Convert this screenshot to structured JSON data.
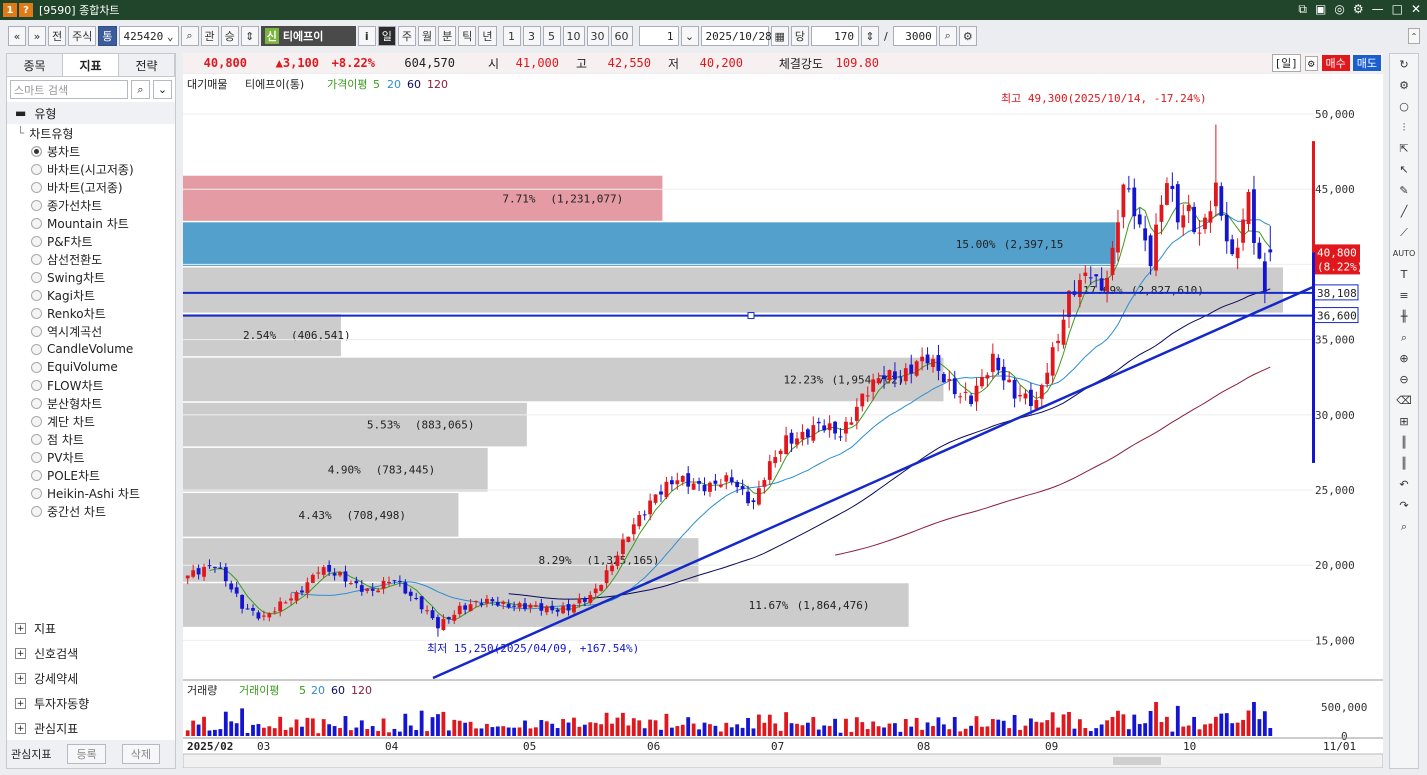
{
  "window": {
    "badge1": "1",
    "badge2": "?",
    "title": "[9590] 종합차트"
  },
  "toolbar": {
    "nav_prev": "«",
    "nav_next": "»",
    "btn_jeon": "전",
    "btn_jusik": "주식",
    "btn_tong": "통",
    "code": "425420",
    "btn_gwan": "관",
    "btn_seung": "승",
    "stock_tag": "신",
    "stock_name": "티에프이",
    "btn_info": "i",
    "periods": [
      "일",
      "주",
      "월",
      "분",
      "틱",
      "년"
    ],
    "intervals": [
      "1",
      "3",
      "5",
      "10",
      "30",
      "60"
    ],
    "unit_value": "1",
    "date": "2025/10/28",
    "btn_dang": "당",
    "count": "170",
    "slash": "/",
    "total": "3000"
  },
  "left_panel": {
    "tabs": [
      "종목",
      "지표",
      "전략"
    ],
    "active_tab": "지표",
    "search_placeholder": "스마트 검색",
    "group_title": "유형",
    "tree_root": "차트유형",
    "chart_types": [
      "봉차트",
      "바차트(시고저종)",
      "바차트(고저종)",
      "종가선차트",
      "Mountain 차트",
      "P&F차트",
      "삼선전환도",
      "Swing차트",
      "Kagi차트",
      "Renko차트",
      "역시계곡선",
      "CandleVolume",
      "EquiVolume",
      "FLOW차트",
      "분산형차트",
      "계단 차트",
      "점 차트",
      "PV차트",
      "POLE차트",
      "Heikin-Ashi 차트",
      "중간선 차트"
    ],
    "selected_chart_type": "봉차트",
    "bottom_groups": [
      "지표",
      "신호검색",
      "강세약세",
      "투자자동향",
      "관심지표"
    ],
    "fav_label": "관심지표",
    "fav_add": "등록",
    "fav_del": "삭제"
  },
  "price_bar": {
    "price": "40,800",
    "change": "▲3,100",
    "change_pct": "+8.22%",
    "volume": "604,570",
    "open_label": "시",
    "open": "41,000",
    "high_label": "고",
    "high": "42,550",
    "low_label": "저",
    "low": "40,200",
    "strength_label": "체결강도",
    "strength": "109.80",
    "period_label": "[일]",
    "buy": "매수",
    "sell": "매도"
  },
  "chart": {
    "legend": {
      "prefix": "대기매물",
      "name": "티에프이(통)",
      "ma_label": "가격이평",
      "ma_periods": [
        "5",
        "20",
        "60",
        "120"
      ]
    },
    "max_annotation": "최고 49,300(2025/10/14, -17.24%)",
    "min_annotation": "최저 15,250(2025/04/09, +167.54%)",
    "current_price_label": "40,800",
    "current_pct_label": "(8.22%)",
    "line_label_1": "38,108",
    "line_label_2": "36,600",
    "yticks": [
      "50,000",
      "45,000",
      "40,000",
      "35,000",
      "30,000",
      "25,000",
      "20,000",
      "15,000"
    ],
    "volume_legend": {
      "prefix": "거래량",
      "ma_label": "거래이평",
      "ma_periods": [
        "5",
        "20",
        "60",
        "120"
      ]
    },
    "volume_ticks": [
      "500,000",
      "0"
    ],
    "xticks": [
      "2025/02",
      "03",
      "04",
      "05",
      "06",
      "07",
      "08",
      "09",
      "10",
      "11/01"
    ],
    "colors": {
      "up": "#e0171c",
      "down": "#1515d0",
      "ma5": "#3c9a1e",
      "ma20": "#2c8fd0",
      "ma60": "#0a0a5e",
      "ma120": "#8b1e3a",
      "trend": "#1529c8"
    }
  },
  "chart_data": {
    "type": "candlestick",
    "volume_profile": [
      {
        "band": [
          42900,
          45900
        ],
        "pct": "7.71%",
        "vol": "(1,231,077)",
        "color": "#e3969f"
      },
      {
        "band": [
          39900,
          42800
        ],
        "pct": "15.00%",
        "vol": "(2,397,15",
        "color": "#4a9bc9"
      },
      {
        "band": [
          36800,
          39800
        ],
        "pct": "17.69%",
        "vol": "(2,827,610)",
        "color": "#c9c9c9"
      },
      {
        "band": [
          33900,
          36700
        ],
        "pct": "2.54%",
        "vol": "(406,541)",
        "color": "#c9c9c9"
      },
      {
        "band": [
          30900,
          33800
        ],
        "pct": "12.23%",
        "vol": "(1,954,702)",
        "color": "#c9c9c9"
      },
      {
        "band": [
          27900,
          30800
        ],
        "pct": "5.53%",
        "vol": "(883,065)",
        "color": "#c9c9c9"
      },
      {
        "band": [
          24900,
          27800
        ],
        "pct": "4.90%",
        "vol": "(783,445)",
        "color": "#c9c9c9"
      },
      {
        "band": [
          21900,
          24800
        ],
        "pct": "4.43%",
        "vol": "(708,498)",
        "color": "#c9c9c9"
      },
      {
        "band": [
          18900,
          21800
        ],
        "pct": "8.29%",
        "vol": "(1,325,165)",
        "color": "#c9c9c9"
      },
      {
        "band": [
          15900,
          18800
        ],
        "pct": "11.67%",
        "vol": "(1,864,476)",
        "color": "#c9c9c9"
      }
    ],
    "waypoints": [
      [
        0,
        19200
      ],
      [
        5,
        20200
      ],
      [
        10,
        17200
      ],
      [
        14,
        16600
      ],
      [
        20,
        18000
      ],
      [
        24,
        19800
      ],
      [
        30,
        18900
      ],
      [
        34,
        18200
      ],
      [
        38,
        19100
      ],
      [
        42,
        17700
      ],
      [
        46,
        15900
      ],
      [
        50,
        17200
      ],
      [
        56,
        17600
      ],
      [
        62,
        17200
      ],
      [
        70,
        17100
      ],
      [
        74,
        17900
      ],
      [
        78,
        20100
      ],
      [
        82,
        22600
      ],
      [
        86,
        24800
      ],
      [
        90,
        25600
      ],
      [
        96,
        25300
      ],
      [
        100,
        25600
      ],
      [
        104,
        24200
      ],
      [
        106,
        25900
      ],
      [
        110,
        28300
      ],
      [
        116,
        29200
      ],
      [
        120,
        28800
      ],
      [
        124,
        31100
      ],
      [
        128,
        32700
      ],
      [
        132,
        32800
      ],
      [
        136,
        33700
      ],
      [
        138,
        33100
      ],
      [
        142,
        31200
      ],
      [
        144,
        30900
      ],
      [
        148,
        33900
      ],
      [
        152,
        31200
      ],
      [
        156,
        30900
      ],
      [
        158,
        33300
      ],
      [
        160,
        35000
      ],
      [
        162,
        37600
      ],
      [
        164,
        38900
      ],
      [
        166,
        39800
      ],
      [
        168,
        38300
      ],
      [
        170,
        40400
      ],
      [
        172,
        45300
      ],
      [
        174,
        43900
      ],
      [
        177,
        40400
      ],
      [
        180,
        45500
      ],
      [
        182,
        43200
      ],
      [
        184,
        43800
      ],
      [
        186,
        41900
      ],
      [
        189,
        44700
      ],
      [
        192,
        40400
      ],
      [
        195,
        44500
      ],
      [
        196,
        41800
      ],
      [
        198,
        37900
      ],
      [
        199,
        40800
      ]
    ],
    "extremes": {
      "high": 49300,
      "low": 15250
    },
    "ylim": [
      12500,
      51200
    ]
  }
}
